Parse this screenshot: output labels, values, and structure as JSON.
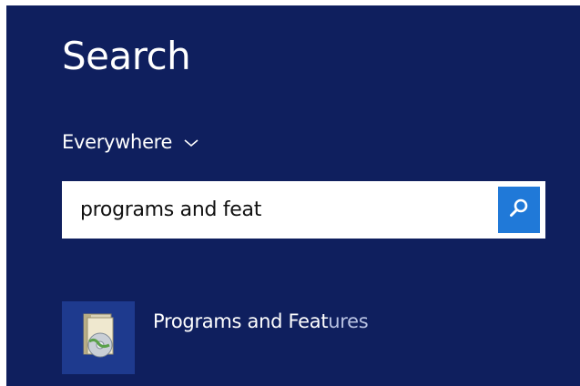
{
  "search_pane": {
    "title": "Search",
    "scope": {
      "label": "Everywhere",
      "icon": "chevron-down-icon"
    },
    "search": {
      "value": "programs and feat",
      "button_icon": "magnifier-icon"
    },
    "results": [
      {
        "label_matched": "Programs and Feat",
        "label_rest": "ures",
        "icon": "programs-and-features-icon"
      }
    ]
  },
  "colors": {
    "background": "#0f1f5e",
    "accent": "#2079d8",
    "result_tile": "#1e3a8e"
  }
}
